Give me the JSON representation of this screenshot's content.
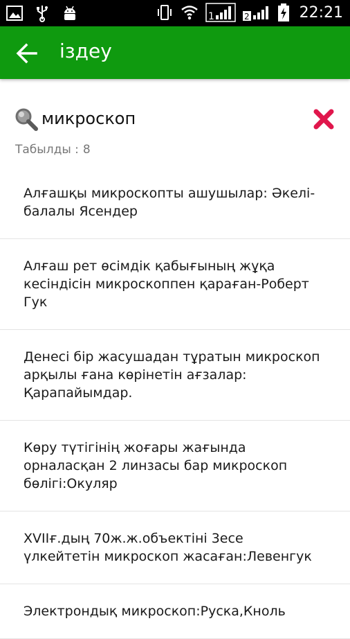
{
  "status_bar": {
    "time": "22:21",
    "sim1_label": "1",
    "sim2_label": "2",
    "icons": [
      "image-icon",
      "usb-icon",
      "android-icon",
      "vibrate-icon",
      "wifi-icon",
      "signal-icon",
      "battery-charging-icon"
    ]
  },
  "app_bar": {
    "title": "іздеу",
    "color": "#0f9a0f"
  },
  "search": {
    "query": "микроскоп",
    "found_label": "Табылды :",
    "found_count": "8",
    "clear_color": "#e0164c"
  },
  "results": [
    "Алғашқы микроскопты ашушылар: Әкелі-балалы Ясендер",
    "Алғаш рет өсімдік қабығының жұқа кесіндісін микроскоппен қараған-Роберт Гук",
    "Денесі бір жасушадан тұратын микроскоп арқылы ғана көрінетін ағзалар: Қарапайымдар.",
    "Көру түтігінің жоғары жағында орналасқан 2 линзасы бар микроскоп бөлігі:Окуляр",
    "XVIIғ.дың 70ж.ж.объектіні 3есе үлкейтетін микроскоп жасаған:Левенгук",
    "Электрондық микроскоп:Руска,Кноль"
  ]
}
